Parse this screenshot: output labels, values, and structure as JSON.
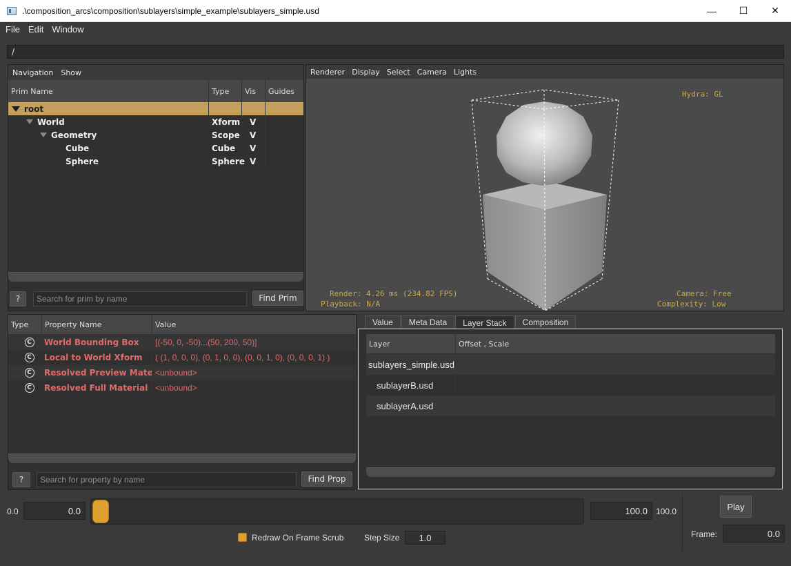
{
  "window": {
    "title": ".\\composition_arcs\\composition\\sublayers\\simple_example\\sublayers_simple.usd",
    "minimize": "—",
    "maximize": "☐",
    "close": "✕"
  },
  "menubar": {
    "file": "File",
    "edit": "Edit",
    "window": "Window"
  },
  "path": "/",
  "prim_panel": {
    "menu": {
      "navigation": "Navigation",
      "show": "Show"
    },
    "columns": {
      "name": "Prim Name",
      "type": "Type",
      "vis": "Vis",
      "guides": "Guides"
    },
    "rows": [
      {
        "name": "root",
        "type": "",
        "vis": ""
      },
      {
        "name": "World",
        "type": "Xform",
        "vis": "V"
      },
      {
        "name": "Geometry",
        "type": "Scope",
        "vis": "V"
      },
      {
        "name": "Cube",
        "type": "Cube",
        "vis": "V"
      },
      {
        "name": "Sphere",
        "type": "Sphere",
        "vis": "V"
      }
    ],
    "help": "?",
    "search_placeholder": "Search for prim by name",
    "find": "Find Prim"
  },
  "viewport": {
    "menu": {
      "renderer": "Renderer",
      "display": "Display",
      "select": "Select",
      "camera": "Camera",
      "lights": "Lights"
    },
    "hud_renderer": "Hydra: GL",
    "hud_render": "Render: 4.26 ms (234.82 FPS)",
    "hud_playback": "Playback: N/A",
    "hud_camera": "Camera: Free",
    "hud_complexity": "Complexity: Low"
  },
  "property_panel": {
    "columns": {
      "type": "Type",
      "name": "Property Name",
      "value": "Value"
    },
    "rows": [
      {
        "icon": "C",
        "name": "World Bounding Box",
        "value": "[(-50, 0, -50)...(50, 200, 50)]"
      },
      {
        "icon": "C",
        "name": "Local to World Xform",
        "value": "( (1, 0, 0, 0), (0, 1, 0, 0), (0, 0, 1, 0), (0, 0, 0, 1) )"
      },
      {
        "icon": "C",
        "name": "Resolved Preview Material",
        "value": "<unbound>"
      },
      {
        "icon": "C",
        "name": "Resolved Full Material",
        "value": "<unbound>"
      }
    ],
    "help": "?",
    "search_placeholder": "Search for property by name",
    "find": "Find Prop"
  },
  "inspector": {
    "tabs": [
      "Value",
      "Meta Data",
      "Layer Stack",
      "Composition"
    ],
    "active_tab": "Layer Stack",
    "columns": {
      "layer": "Layer",
      "offset": "Offset , Scale"
    },
    "layers": [
      "sublayers_simple.usd",
      "sublayerB.usd",
      "sublayerA.usd"
    ]
  },
  "timeline": {
    "start_label": "0.0",
    "start_value": "0.0",
    "end_value": "100.0",
    "end_label": "100.0",
    "slider_position": 0,
    "redraw_label": "Redraw On Frame Scrub",
    "redraw_checked": true,
    "step_label": "Step Size",
    "step_value": "1.0",
    "play": "Play",
    "frame_label": "Frame:",
    "frame_value": "0.0"
  },
  "colors": {
    "accent": "#e0a030",
    "selection": "#c4a05c",
    "property_text": "#e06a68",
    "hud": "#c9a84e"
  }
}
